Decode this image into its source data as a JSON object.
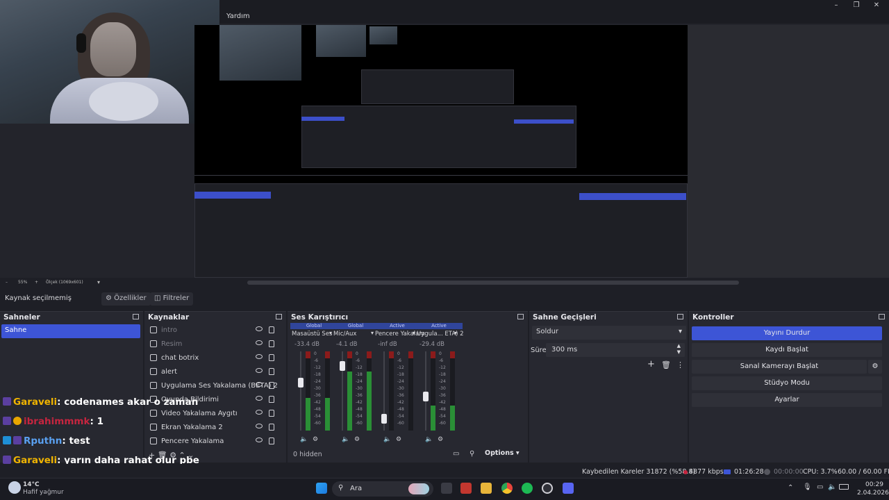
{
  "window": {
    "menu_help": "Yardım",
    "minimize": "–",
    "maximize": "❐",
    "close": "✕"
  },
  "zoombar": {
    "minus": "–",
    "zoom": "55%",
    "plus": "+",
    "scale": "Ölçek (1069x601)",
    "dropdown": "▾"
  },
  "source_toolbar": {
    "no_source": "Kaynak seçilmemiş",
    "properties": "Özellikler",
    "filters": "Filtreler"
  },
  "scenes": {
    "title": "Sahneler",
    "items": [
      "Sahne"
    ]
  },
  "sources": {
    "title": "Kaynaklar",
    "items": [
      {
        "label": "intro",
        "visible": false
      },
      {
        "label": "Resim",
        "visible": false
      },
      {
        "label": "chat botrix",
        "visible": true
      },
      {
        "label": "alert",
        "visible": true
      },
      {
        "label": "Uygulama Ses Yakalama (BETA) 2",
        "visible": true
      },
      {
        "label": "Oyunda Bildirimi",
        "visible": true
      },
      {
        "label": "Video Yakalama Aygıtı",
        "visible": true
      },
      {
        "label": "Ekran Yakalama 2",
        "visible": true
      },
      {
        "label": "Pencere Yakalama",
        "visible": true
      }
    ]
  },
  "mixer": {
    "title": "Ses Karıştırıcı",
    "channels": [
      {
        "tag": "Global",
        "name": "Masaüstü Ses",
        "db": "-33.4 dB",
        "level": 0.45,
        "fader": 0.62
      },
      {
        "tag": "Global",
        "name": "Mic/Aux",
        "db": "-4.1 dB",
        "level": 0.82,
        "fader": 0.86
      },
      {
        "tag": "Active",
        "name": "Pencere Yakalam",
        "db": "-inf dB",
        "level": 0.0,
        "fader": 0.1
      },
      {
        "tag": "Active",
        "name": "Uygula... ETA) 2",
        "db": "-29.4 dB",
        "level": 0.35,
        "fader": 0.42
      }
    ],
    "ticks": [
      "0",
      "-6",
      "-12",
      "-18",
      "-24",
      "-30",
      "-36",
      "-42",
      "-48",
      "-54",
      "-60"
    ],
    "hidden": "0 hidden",
    "options": "Options"
  },
  "transitions": {
    "title": "Sahne Geçişleri",
    "selected": "Soldur",
    "duration_label": "Süre",
    "duration_value": "300 ms"
  },
  "controls": {
    "title": "Kontroller",
    "buttons": [
      "Yayını Durdur",
      "Kaydı Başlat",
      "Sanal Kamerayı Başlat",
      "Stüdyo Modu",
      "Ayarlar"
    ]
  },
  "chat": [
    {
      "user": "Garaveli",
      "msg": ": codenames akar o zaman",
      "color": "#f0b400"
    },
    {
      "user": "ibrahimmmk",
      "msg": ": 1",
      "color": "#c6253f"
    },
    {
      "user": "Rputhn",
      "msg": ": test",
      "color": "#5aa0f0"
    },
    {
      "user": "Garaveli",
      "msg": ": yarın daha rahat olur pbe",
      "color": "#f0b400"
    }
  ],
  "status": {
    "dropped": "Kaybedilen Kareler 31872 (%58.8)",
    "bitrate": "4877 kbps",
    "live_time": "01:26:28",
    "rec_time": "00:00:00",
    "cpu": "CPU: 3.7%",
    "fps": "60.00 / 60.00 FPS"
  },
  "taskbar": {
    "weather_temp": "14°C",
    "weather_desc": "Hafif yağmur",
    "search": "Ara",
    "time": "00:29",
    "date": "2.04.2026"
  },
  "colors": {
    "accent": "#3d55d6",
    "meter_green": "#2a8f36",
    "meter_red": "#8b1b1b"
  }
}
